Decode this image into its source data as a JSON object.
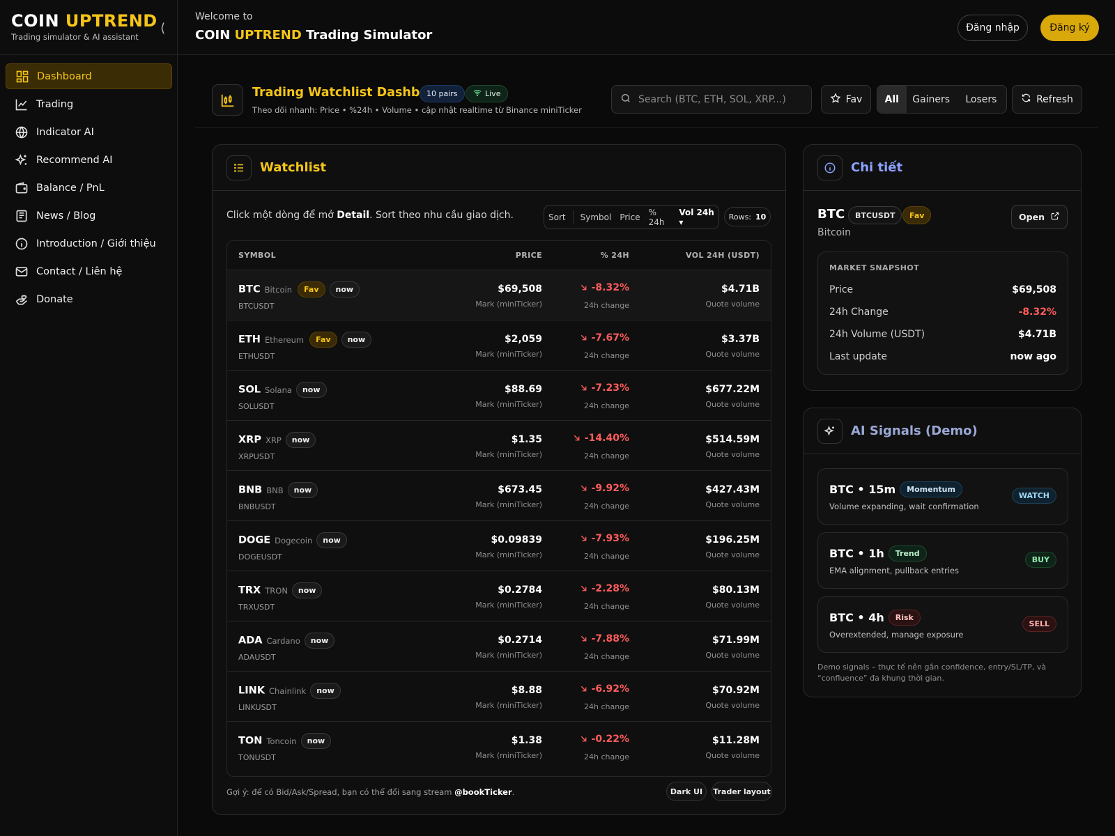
{
  "brand": {
    "name_part1": "COIN",
    "name_part2": "UPTREND",
    "tagline": "Trading simulator & AI assistant",
    "collapse_glyph": "⟨"
  },
  "sidebar": {
    "items": [
      {
        "label": "Dashboard",
        "icon": "dashboard-icon"
      },
      {
        "label": "Trading",
        "icon": "chart-line-icon"
      },
      {
        "label": "Indicator AI",
        "icon": "globe-icon"
      },
      {
        "label": "Recommend AI",
        "icon": "sparkles-icon"
      },
      {
        "label": "Balance / PnL",
        "icon": "wallet-icon"
      },
      {
        "label": "News / Blog",
        "icon": "newspaper-icon"
      },
      {
        "label": "Introduction / Giới thiệu",
        "icon": "info-icon"
      },
      {
        "label": "Contact / Liên hệ",
        "icon": "mail-icon"
      },
      {
        "label": "Donate",
        "icon": "hand-heart-icon"
      }
    ]
  },
  "header": {
    "welcome": "Welcome to",
    "title_part1": "COIN",
    "title_part2": "UPTREND",
    "title_part3": "Trading Simulator",
    "login_label": "Đăng nhập",
    "register_label": "Đăng ký"
  },
  "dashboard": {
    "title": "Trading Watchlist Dashboard",
    "pairs_badge": "10 pairs",
    "live_badge": "Live",
    "subtitle": "Theo dõi nhanh: Price • %24h • Volume • cập nhật realtime từ Binance miniTicker",
    "search_placeholder": "Search (BTC, ETH, SOL, XRP...)",
    "fav_label": "Fav",
    "filters": [
      "All",
      "Gainers",
      "Losers"
    ],
    "refresh_label": "Refresh"
  },
  "watchlist": {
    "title": "Watchlist",
    "hint_pre": "Click một dòng để mở ",
    "hint_bold": "Detail",
    "hint_post": ". Sort theo nhu cầu giao dịch.",
    "sort_label": "Sort",
    "sort_options": [
      "Symbol",
      "Price",
      "% 24h",
      "Vol 24h ▾"
    ],
    "rows_label": "Rows:",
    "rows_value": "10",
    "columns": {
      "symbol": "SYMBOL",
      "price": "PRICE",
      "change": "% 24H",
      "volume": "VOL 24H (USDT)"
    },
    "price_sub": "Mark (miniTicker)",
    "change_sub": "24h change",
    "volume_sub": "Quote volume",
    "fav_tag": "Fav",
    "now_tag": "now",
    "rows": [
      {
        "sym": "BTC",
        "name": "Bitcoin",
        "fav": true,
        "pair": "BTCUSDT",
        "price": "$69,508",
        "change": "-8.32%",
        "volume": "$4.71B"
      },
      {
        "sym": "ETH",
        "name": "Ethereum",
        "fav": true,
        "pair": "ETHUSDT",
        "price": "$2,059",
        "change": "-7.67%",
        "volume": "$3.37B"
      },
      {
        "sym": "SOL",
        "name": "Solana",
        "fav": false,
        "pair": "SOLUSDT",
        "price": "$88.69",
        "change": "-7.23%",
        "volume": "$677.22M"
      },
      {
        "sym": "XRP",
        "name": "XRP",
        "fav": false,
        "pair": "XRPUSDT",
        "price": "$1.35",
        "change": "-14.40%",
        "volume": "$514.59M"
      },
      {
        "sym": "BNB",
        "name": "BNB",
        "fav": false,
        "pair": "BNBUSDT",
        "price": "$673.45",
        "change": "-9.92%",
        "volume": "$427.43M"
      },
      {
        "sym": "DOGE",
        "name": "Dogecoin",
        "fav": false,
        "pair": "DOGEUSDT",
        "price": "$0.09839",
        "change": "-7.93%",
        "volume": "$196.25M"
      },
      {
        "sym": "TRX",
        "name": "TRON",
        "fav": false,
        "pair": "TRXUSDT",
        "price": "$0.2784",
        "change": "-2.28%",
        "volume": "$80.13M"
      },
      {
        "sym": "ADA",
        "name": "Cardano",
        "fav": false,
        "pair": "ADAUSDT",
        "price": "$0.2714",
        "change": "-7.88%",
        "volume": "$71.99M"
      },
      {
        "sym": "LINK",
        "name": "Chainlink",
        "fav": false,
        "pair": "LINKUSDT",
        "price": "$8.88",
        "change": "-6.92%",
        "volume": "$70.92M"
      },
      {
        "sym": "TON",
        "name": "Toncoin",
        "fav": false,
        "pair": "TONUSDT",
        "price": "$1.38",
        "change": "-0.22%",
        "volume": "$11.28M"
      }
    ],
    "footer_pre": "Gợi ý: để có Bid/Ask/Spread, bạn có thể đổi sang stream ",
    "footer_bold": "@bookTicker",
    "footer_post": ".",
    "footer_pill1": "Dark UI",
    "footer_pill2": "Trader layout"
  },
  "detail": {
    "title": "Chi tiết",
    "symbol": "BTC",
    "pair": "BTCUSDT",
    "fav": "Fav",
    "name": "Bitcoin",
    "open_label": "Open",
    "snapshot_title": "MARKET SNAPSHOT",
    "snapshot": [
      {
        "k": "Price",
        "v": "$69,508"
      },
      {
        "k": "24h Change",
        "v": "-8.32%"
      },
      {
        "k": "24h Volume (USDT)",
        "v": "$4.71B"
      },
      {
        "k": "Last update",
        "v": "now ago"
      }
    ]
  },
  "signals": {
    "title": "AI Signals (Demo)",
    "items": [
      {
        "title": "BTC • 15m",
        "tag": "Momentum",
        "desc": "Volume expanding, wait confirmation",
        "action": "WATCH",
        "color": "#6ec7f0"
      },
      {
        "title": "BTC • 1h",
        "tag": "Trend",
        "desc": "EMA alignment, pullback entries",
        "action": "BUY",
        "color": "#5fd38a"
      },
      {
        "title": "BTC • 4h",
        "tag": "Risk",
        "desc": "Overextended, manage exposure",
        "action": "SELL",
        "color": "#ff6b6b"
      }
    ],
    "note": "Demo signals – thực tế nên gắn confidence, entry/SL/TP, và “confluence” đa khung thời gian."
  },
  "colors": {
    "accent": "#f5c518",
    "negative": "#ff5c5c",
    "detail_title": "#8ea2ff",
    "signals_title": "#9aa8d6"
  }
}
